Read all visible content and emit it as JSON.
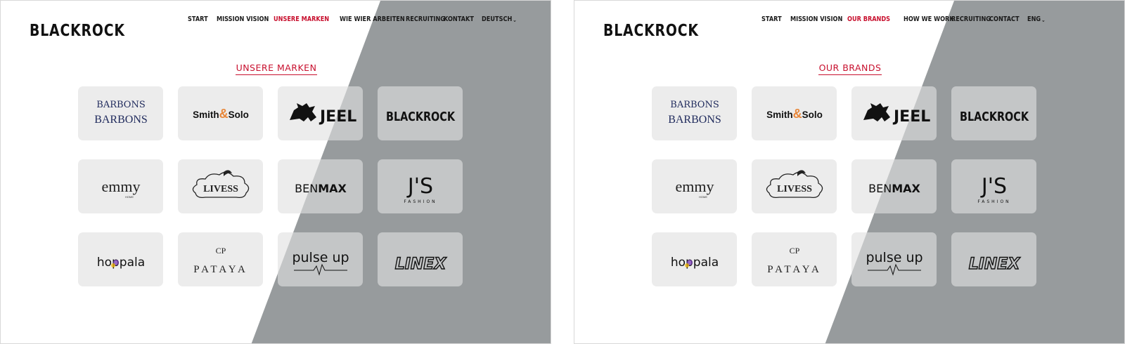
{
  "pages": [
    {
      "lang": "de",
      "brand": "BLACKROCK",
      "nav": [
        {
          "label": "START",
          "active": false
        },
        {
          "label": "MISSION VISION",
          "active": false
        },
        {
          "label": "UNSERE MARKEN",
          "active": true
        },
        {
          "label": "WIE WIER ARBEITEN",
          "active": false
        },
        {
          "label": "RECRUITING",
          "active": false
        },
        {
          "label": "KONTAKT",
          "active": false
        },
        {
          "label": "DEUTSCH",
          "active": false,
          "dropdown": true
        }
      ],
      "heading": "UNSERE MARKEN"
    },
    {
      "lang": "en",
      "brand": "BLACKROCK",
      "nav": [
        {
          "label": "START",
          "active": false
        },
        {
          "label": "MISSION VISION",
          "active": false
        },
        {
          "label": "OUR BRANDS",
          "active": true
        },
        {
          "label": "HOW WE WORK",
          "active": false
        },
        {
          "label": "RECRUITING",
          "active": false
        },
        {
          "label": "CONTACT",
          "active": false
        },
        {
          "label": "ENG",
          "active": false,
          "dropdown": true
        }
      ],
      "heading": "OUR BRANDS"
    }
  ],
  "brands": [
    {
      "id": "barbons",
      "text": "BARBONS"
    },
    {
      "id": "smith-solo",
      "text": "Smith",
      "amp": "&",
      "text2": "Solo"
    },
    {
      "id": "jeel",
      "text": "JEEL"
    },
    {
      "id": "blackrock",
      "text": "BLACKROCK"
    },
    {
      "id": "emmy",
      "text": "emmy",
      "sub": "HOME"
    },
    {
      "id": "livess",
      "text": "LIVESS"
    },
    {
      "id": "benmax",
      "text": "BEN",
      "text2": "MAX"
    },
    {
      "id": "js",
      "text": "J'S",
      "sub": "FASHION"
    },
    {
      "id": "hoppala",
      "text": "hoppala"
    },
    {
      "id": "pataya",
      "text": "PATAYA",
      "mark": "CP"
    },
    {
      "id": "pulseup",
      "text": "pulse up"
    },
    {
      "id": "linex",
      "text": "LINEX"
    }
  ],
  "colors": {
    "accent": "#c8102e",
    "diagonal": "#979b9d",
    "card": "#e1e1e1",
    "amp": "#e8873a",
    "barbons": "#1f2a5c"
  }
}
